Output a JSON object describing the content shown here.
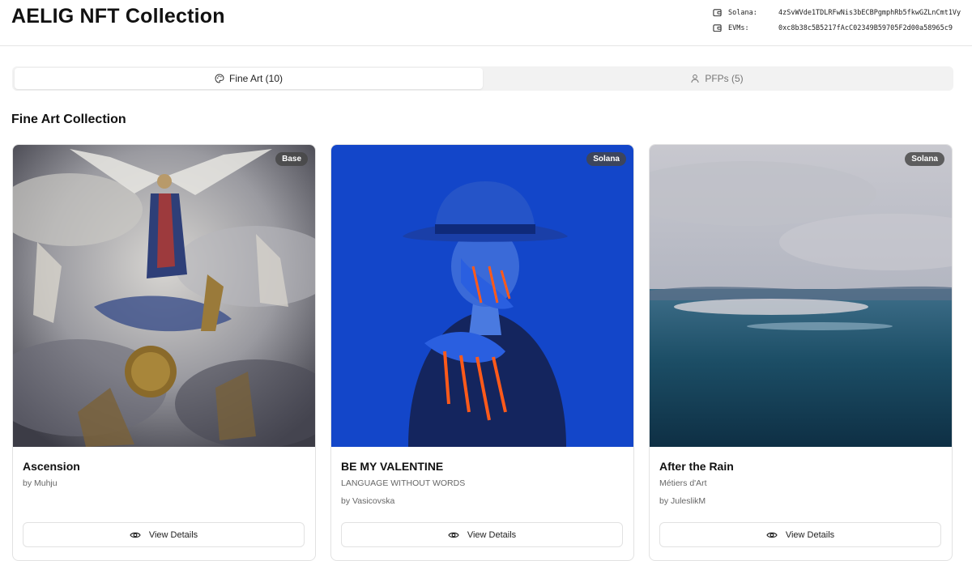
{
  "header": {
    "title": "AELIG NFT Collection",
    "wallets": [
      {
        "label": "Solana:",
        "address": "4zSvWVde1TDLRFwNis3bECBPgmphRb5fkwGZLnCmt1Vy",
        "icon": "wallet-icon"
      },
      {
        "label": "EVMs:",
        "address": "0xc8b38c5B5217fAcC02349B59705F2d00a58965c9",
        "icon": "wallet-icon"
      }
    ]
  },
  "tabs": [
    {
      "label": "Fine Art (10)",
      "icon": "palette-icon",
      "active": true
    },
    {
      "label": "PFPs (5)",
      "icon": "user-icon",
      "active": false
    }
  ],
  "section": {
    "title": "Fine Art Collection"
  },
  "cards": [
    {
      "title": "Ascension",
      "subtitle": "",
      "artist": "by Muhju",
      "badge": "Base",
      "button": "View Details"
    },
    {
      "title": "BE MY VALENTINE",
      "subtitle": "LANGUAGE WITHOUT WORDS",
      "artist": "by Vasicovska",
      "badge": "Solana",
      "button": "View Details"
    },
    {
      "title": "After the Rain",
      "subtitle": "Métiers d'Art",
      "artist": "by JuleslikM",
      "badge": "Solana",
      "button": "View Details"
    }
  ],
  "colors": {
    "accent": "#111111",
    "tab_bg": "#f2f2f2",
    "badge_bg": "#464646"
  }
}
